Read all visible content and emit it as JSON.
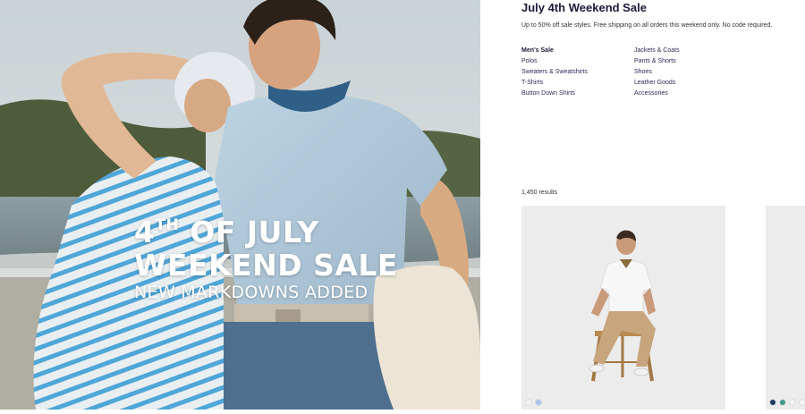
{
  "hero": {
    "line1_main": "4",
    "line1_sup": "TH",
    "line1_rest": " OF JULY",
    "line2": "WEEKEND SALE",
    "line3": "NEW MARKDOWNS ADDED"
  },
  "page": {
    "title": "July 4th Weekend Sale",
    "subtitle": "Up to 50% off sale styles. Free shipping on all orders this weekend only. No code required."
  },
  "categories": {
    "col1": [
      "Men's Sale",
      "Polos",
      "Sweaters & Sweatshirts",
      "T-Shirts",
      "Button Down Shirts"
    ],
    "col2": [
      "Jackets & Coats",
      "Pants & Shorts",
      "Shoes",
      "Leather Goods",
      "Accessories"
    ]
  },
  "results_count": "1,450 results",
  "products": [
    {
      "swatches": [
        "#f2f2f2",
        "#a9c4e8"
      ]
    },
    {
      "swatches": [
        "#1d3a5f",
        "#3e9a8c",
        "#f2f2f2",
        "#f2f2f2"
      ]
    }
  ],
  "colors": {
    "title": "#1a1a3a",
    "link": "#2a2a5a"
  }
}
